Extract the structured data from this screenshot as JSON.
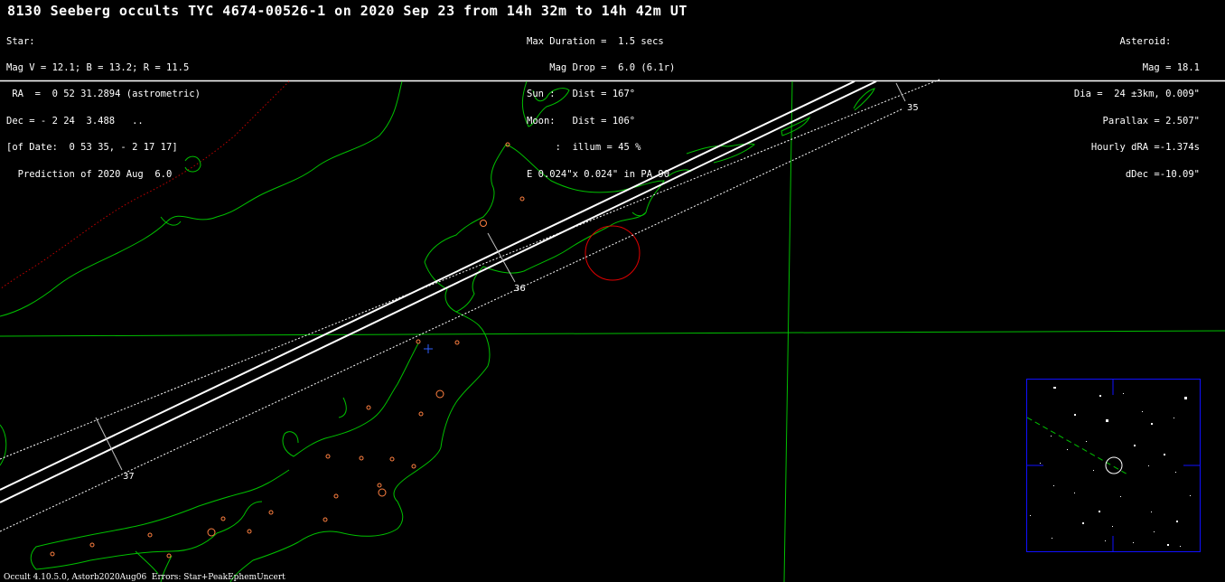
{
  "title": "8130 Seeberg occults TYC 4674-00526-1 on 2020 Sep 23 from 14h 32m to 14h 42m UT",
  "star_info": [
    "Star:",
    "Mag V = 12.1; B = 13.2; R = 11.5",
    " RA  =  0 52 31.2894 (astrometric)",
    "Dec = - 2 24  3.488   ..",
    "[of Date:  0 53 35, - 2 17 17]",
    "  Prediction of 2020 Aug  6.0"
  ],
  "event_info": [
    "Max Duration =  1.5 secs",
    "    Mag Drop =  6.0 (6.1r)",
    "Sun :   Dist = 167°",
    "Moon:   Dist = 106°",
    "     :  illum = 45 %",
    "E 0.024\"x 0.024\" in PA 90"
  ],
  "asteroid_info": [
    "Asteroid:     ",
    "Mag = 18.1",
    "Dia =  24 ±3km, 0.009\"",
    "Parallax = 2.507\"",
    "Hourly dRA =-1.374s",
    "dDec =-10.09\""
  ],
  "time_ticks": [
    "35",
    "36",
    "37"
  ],
  "footer": "Occult 4.10.5.0, Astorb2020Aug06  Errors: Star+PeakEphemUncert",
  "colors": {
    "background": "#000000",
    "coastline": "#00c000",
    "path_lines": "#ffffff",
    "city_markers": "#ff8040",
    "radar_circle": "#e00000",
    "border_dots": "#c00000",
    "finder_frame": "#0000ff",
    "grid": "#00c000"
  }
}
